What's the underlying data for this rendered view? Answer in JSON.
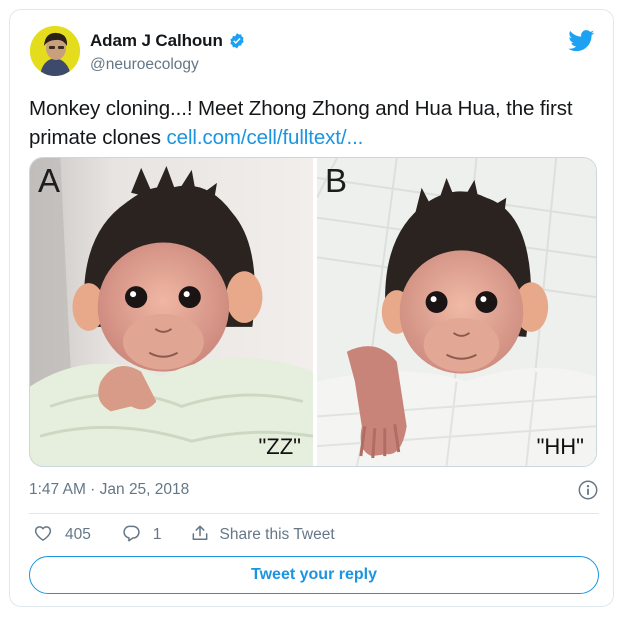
{
  "author": {
    "name": "Adam J Calhoun",
    "handle": "@neuroecology"
  },
  "tweet": {
    "text": "Monkey cloning...! Meet Zhong Zhong and Hua Hua, the first primate clones ",
    "link_text": "cell.com/cell/fulltext/..."
  },
  "media": {
    "panels": [
      {
        "letter": "A",
        "caption": "\"ZZ\""
      },
      {
        "letter": "B",
        "caption": "\"HH\""
      }
    ]
  },
  "meta": {
    "timestamp": "1:47 AM · Jan 25, 2018"
  },
  "actions": {
    "likes_count": "405",
    "replies_count": "1",
    "share_label": "Share this Tweet"
  },
  "reply_button_label": "Tweet your reply",
  "colors": {
    "accent": "#1b95e0",
    "secondary_text": "#657786",
    "border": "#e1e8ed"
  },
  "icons": [
    "verified-badge-icon",
    "twitter-bird-icon",
    "info-icon",
    "heart-icon",
    "reply-bubble-icon",
    "share-icon"
  ]
}
